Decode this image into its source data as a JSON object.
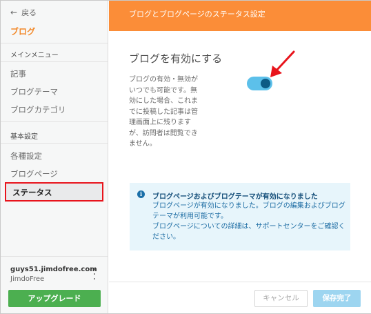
{
  "sidebar": {
    "back_label": "戻る",
    "title": "ブログ",
    "main_menu_heading": "メインメニュー",
    "main_menu_items": [
      "記事",
      "ブログテーマ",
      "ブログカテゴリ"
    ],
    "basic_settings_heading": "基本設定",
    "basic_settings_items": [
      "各種設定",
      "ブログページ",
      "ステータス"
    ],
    "active_item": "ステータス",
    "account": {
      "domain": "guys51.jimdofree.com",
      "provider": "JimdoFree"
    },
    "upgrade_label": "アップグレード"
  },
  "header": {
    "title": "ブログとブログページのステータス設定"
  },
  "main": {
    "section_title": "ブログを有効にする",
    "description": "ブログの有効・無効がいつでも可能です。無効にした場合、これまでに投稿した記事は管理画面上に残りますが、訪問者は閲覧できません。",
    "toggle_on": true,
    "info": {
      "title": "ブログページおよびブログテーマが有効になりました",
      "body_line1": "ブログページが有効になりました。ブログの編集およびブログテーマが利用可能です。",
      "body_line2": "ブログページについての詳細は、サポートセンターをご確認ください。"
    }
  },
  "footer": {
    "cancel_label": "キャンセル",
    "save_label": "保存完了"
  },
  "colors": {
    "accent_orange": "#fb8d38",
    "toggle_track": "#5cc0ea",
    "toggle_knob": "#0d5a85",
    "upgrade_green": "#4caf50",
    "highlight_red": "#e8141c"
  }
}
